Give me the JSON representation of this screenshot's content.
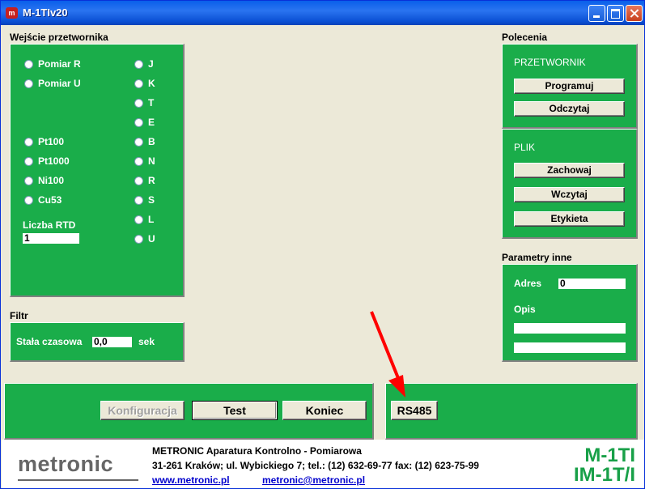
{
  "window": {
    "title": "M-1TIv20",
    "icon_text": "m"
  },
  "input_section": {
    "label": "Wejście przetwornika",
    "left_options": [
      "Pomiar R",
      "Pomiar U",
      "Pt100",
      "Pt1000",
      "Ni100",
      "Cu53"
    ],
    "right_options": [
      "J",
      "K",
      "T",
      "E",
      "B",
      "N",
      "R",
      "S",
      "L",
      "U"
    ],
    "rtd_label": "Liczba RTD",
    "rtd_value": "1"
  },
  "filter_section": {
    "label": "Filtr",
    "time_constant_label": "Stała czasowa",
    "time_constant_value": "0,0",
    "unit": "sek"
  },
  "commands_section": {
    "label": "Polecenia",
    "converter_title": "PRZETWORNIK",
    "program_button": "Programuj",
    "read_button": "Odczytaj",
    "file_title": "PLIK",
    "save_button": "Zachowaj",
    "load_button": "Wczytaj",
    "label_button": "Etykieta"
  },
  "other_params": {
    "label": "Parametry inne",
    "address_label": "Adres",
    "address_value": "0",
    "description_label": "Opis",
    "description_line1": "",
    "description_line2": ""
  },
  "bottom_buttons": {
    "config": "Konfiguracja",
    "test": "Test",
    "exit": "Koniec",
    "rs485": "RS485"
  },
  "footer": {
    "logo_text": "metronic",
    "company": "METRONIC Aparatura Kontrolno - Pomiarowa",
    "address": "31-261 Kraków;   ul. Wybickiego 7; tel.: (12) 632-69-77    fax: (12) 623-75-99",
    "website": "www.metronic.pl",
    "email": "metronic@metronic.pl",
    "product_line1": "M-1TI",
    "product_line2": "IM-1T/I"
  },
  "annotation": {
    "arrow_color": "#ff0000"
  },
  "colors": {
    "panel_green": "#1aad4a",
    "product_green": "#18a048"
  }
}
